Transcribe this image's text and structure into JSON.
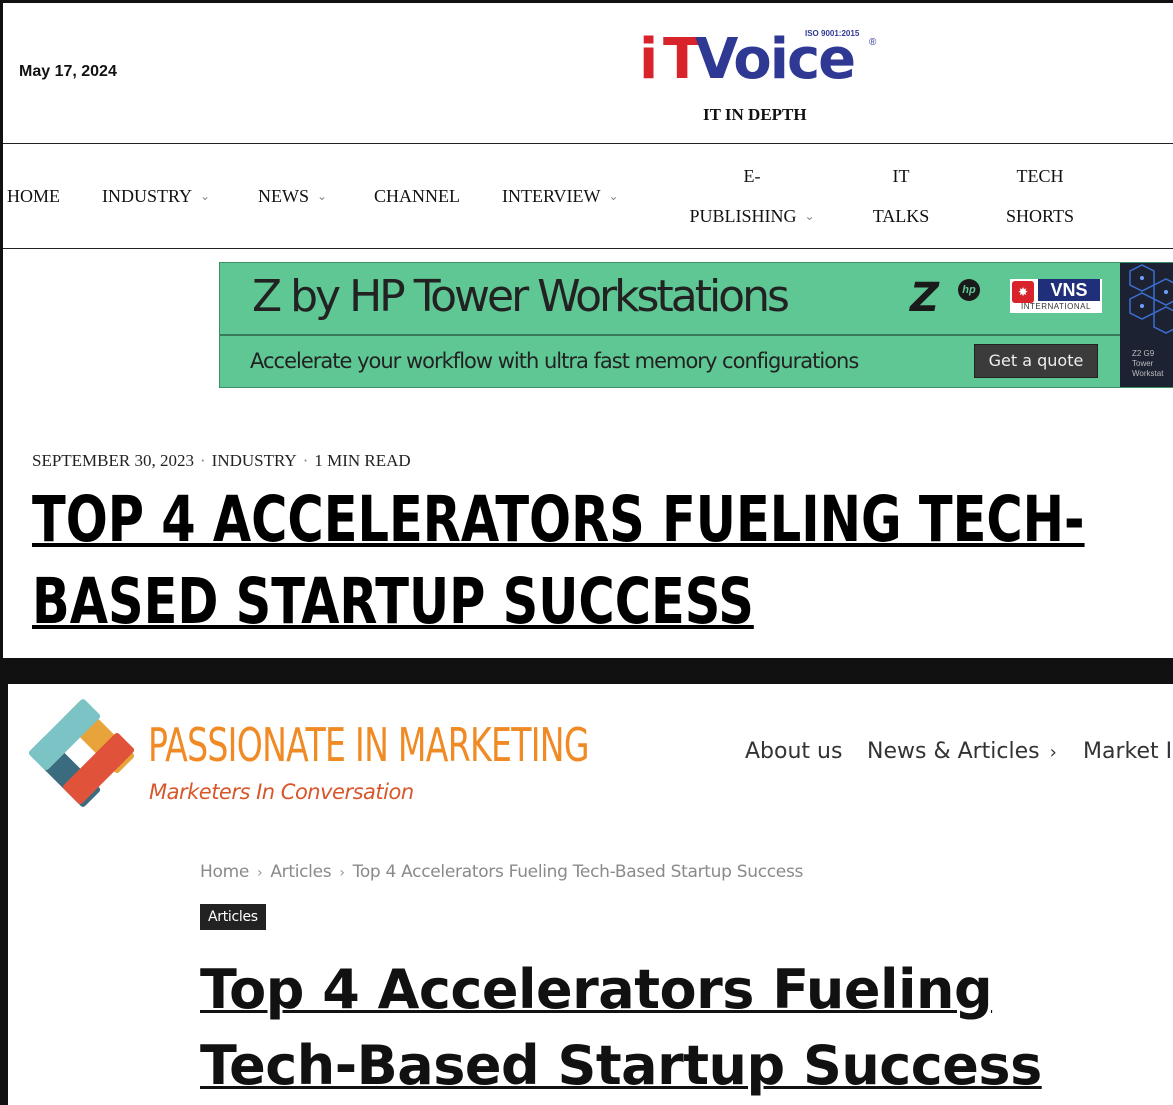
{
  "itvoice": {
    "date": "May 17, 2024",
    "logo": {
      "i": "i",
      "t": "T",
      "voice": "Voice",
      "iso": "ISO 9001:2015",
      "reg": "®"
    },
    "tagline": "IT IN DEPTH",
    "nav": {
      "home": "HOME",
      "industry": "INDUSTRY",
      "news": "NEWS",
      "channel": "CHANNEL",
      "interview": "INTERVIEW",
      "epublishing_1": "E-",
      "epublishing_2": "PUBLISHING",
      "ittalks_1": "IT",
      "ittalks_2": "TALKS",
      "techshorts_1": "TECH",
      "techshorts_2": "SHORTS"
    },
    "ad": {
      "title": "Z by HP Tower Workstations",
      "subtitle": "Accelerate your workflow with ultra fast memory configurations",
      "cta": "Get a quote",
      "brand_z": "Z",
      "brand_hp": "hp",
      "partner": "VNS",
      "partner_sub": "INTERNATIONAL",
      "side_text": "Z2 G9\nTower\nWorkstat",
      "background_color": "#5fc794"
    },
    "article": {
      "date": "SEPTEMBER 30, 2023",
      "category": "INDUSTRY",
      "read_time": "1 MIN READ",
      "headline": "TOP 4 ACCELERATORS FUELING TECH-BASED STARTUP SUCCESS"
    }
  },
  "pim": {
    "logo": {
      "name": "PASSIONATE IN MARKETING",
      "tagline": "Marketers In Conversation",
      "brand_color": "#f08a24"
    },
    "nav": {
      "about": "About us",
      "news": "News & Articles",
      "market": "Market I"
    },
    "breadcrumb": [
      "Home",
      "Articles",
      "Top 4 Accelerators Fueling Tech-Based Startup Success"
    ],
    "category": "Articles",
    "headline": "Top 4 Accelerators Fueling Tech-Based Startup Success"
  }
}
